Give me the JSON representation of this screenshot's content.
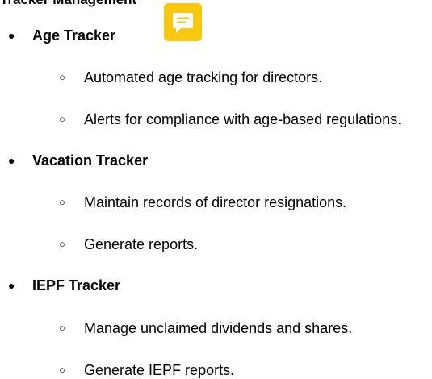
{
  "document": {
    "heading": "Tracker Management",
    "bullet_marker": "●",
    "sub_bullet_marker": "○",
    "comment_icon": "comment-icon",
    "comment_icon_color": "#f9c80e",
    "sections": [
      {
        "title": "Age Tracker",
        "items": [
          "Automated age tracking for directors.",
          "Alerts for compliance with age-based regulations."
        ]
      },
      {
        "title": "Vacation Tracker",
        "items": [
          "Maintain records of director resignations.",
          "Generate reports."
        ]
      },
      {
        "title": "IEPF Tracker",
        "items": [
          "Manage unclaimed dividends and shares.",
          "Generate IEPF reports."
        ]
      }
    ]
  }
}
